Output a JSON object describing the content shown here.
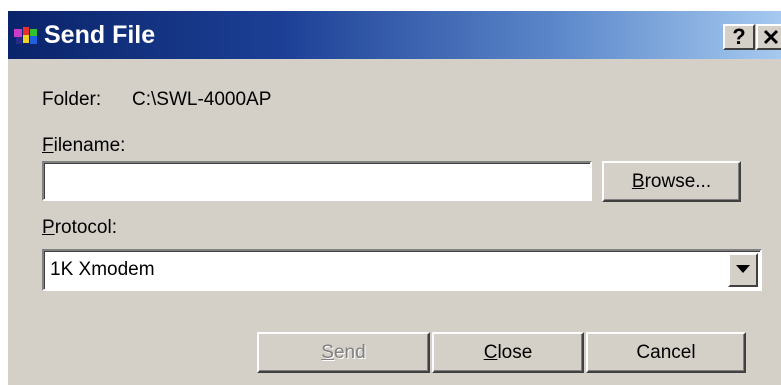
{
  "window": {
    "title": "Send File",
    "help_button": "?",
    "close_button": "✕"
  },
  "folder": {
    "label": "Folder:",
    "path": "C:\\SWL-4000AP"
  },
  "filename": {
    "label_accel": "F",
    "label_rest": "ilename:",
    "value": ""
  },
  "browse_button": {
    "accel": "B",
    "rest": "rowse..."
  },
  "protocol": {
    "label_accel": "P",
    "label_rest": "rotocol:",
    "selected": "1K Xmodem"
  },
  "buttons": {
    "send": {
      "accel": "S",
      "rest": "end",
      "enabled": false
    },
    "close": {
      "accel": "C",
      "rest": "lose"
    },
    "cancel": "Cancel"
  },
  "colors": {
    "dialog_face": "#d4d0c8",
    "titlebar_start": "#0a246a",
    "titlebar_end": "#a6caf0",
    "disabled_text": "#808080"
  },
  "icons": {
    "app": "transfer-app-icon",
    "help": "question-mark-icon",
    "close": "close-x-icon",
    "dropdown": "triangle-down-icon"
  }
}
